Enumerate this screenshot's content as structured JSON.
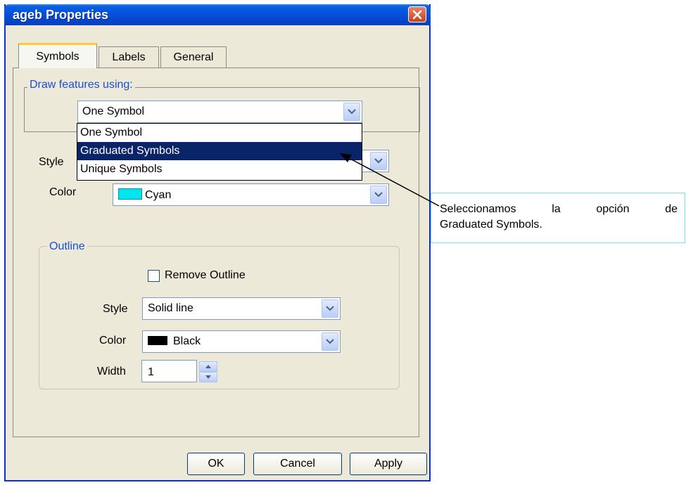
{
  "window": {
    "title": "ageb Properties"
  },
  "tabs": [
    {
      "label": "Symbols",
      "active": true
    },
    {
      "label": "Labels",
      "active": false
    },
    {
      "label": "General",
      "active": false
    }
  ],
  "draw_group": {
    "legend": "Draw features using:",
    "selected": "One Symbol",
    "options": [
      "One Symbol",
      "Graduated Symbols",
      "Unique Symbols"
    ],
    "highlighted": "Graduated Symbols"
  },
  "symbol": {
    "style_label": "Style",
    "color_label": "Color",
    "color_value": "Cyan",
    "color_hex": "#00e5ee"
  },
  "outline": {
    "legend": "Outline",
    "remove_label": "Remove Outline",
    "remove_checked": false,
    "style_label": "Style",
    "style_value": "Solid line",
    "color_label": "Color",
    "color_value": "Black",
    "color_hex": "#000000",
    "width_label": "Width",
    "width_value": "1"
  },
  "buttons": {
    "ok": "OK",
    "cancel": "Cancel",
    "apply": "Apply"
  },
  "callout": {
    "line1": "Seleccionamos la opción de",
    "line2": "Graduated Symbols."
  }
}
